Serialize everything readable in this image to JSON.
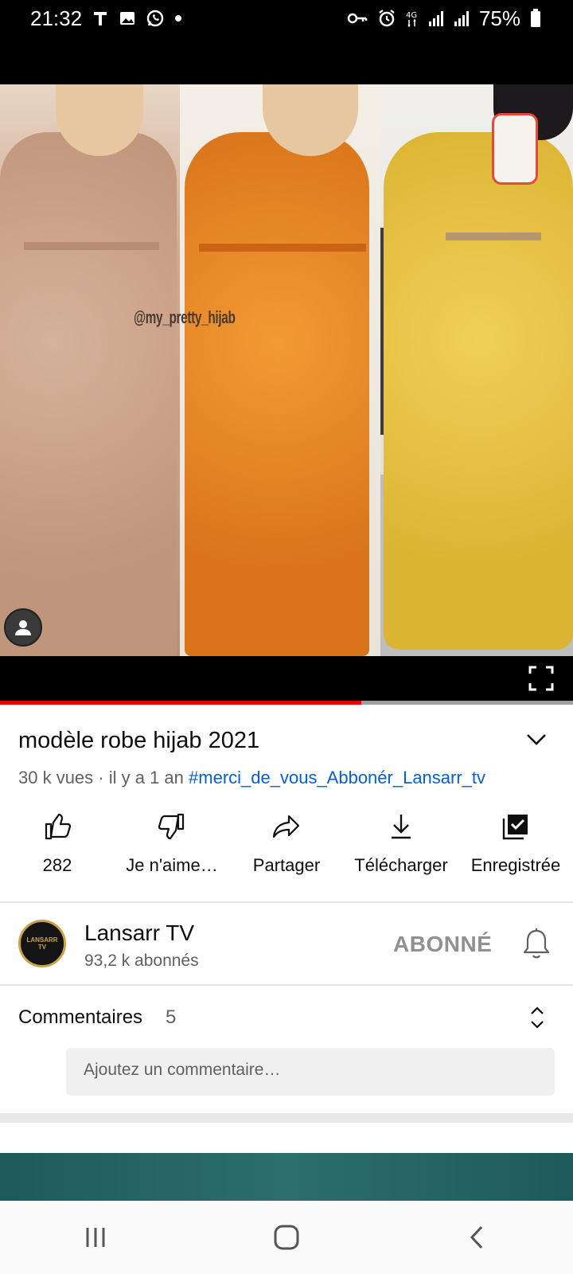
{
  "status_bar": {
    "time": "21:32",
    "battery": "75%",
    "icons": [
      "t-icon",
      "image-icon",
      "whatsapp-icon",
      "dot-icon",
      "key-icon",
      "alarm-icon",
      "4g-icon",
      "signal-icon",
      "signal-icon",
      "battery-icon"
    ]
  },
  "video": {
    "watermark": "@my_pretty_hijab",
    "progress_fraction": 0.63
  },
  "title": "modèle robe hijab 2021",
  "meta": {
    "info": "30 k vues · il y a 1 an",
    "hashtag": "#merci_de_vous_Abbonér_Lansarr_tv"
  },
  "actions": [
    {
      "label": "282",
      "icon": "thumbs-up-icon"
    },
    {
      "label": "Je n'aime…",
      "icon": "thumbs-down-icon"
    },
    {
      "label": "Partager",
      "icon": "share-icon"
    },
    {
      "label": "Télécharger",
      "icon": "download-icon"
    },
    {
      "label": "Enregistrée",
      "icon": "saved-playlist-icon"
    }
  ],
  "channel": {
    "name": "Lansarr TV",
    "subscribers": "93,2 k abonnés",
    "subscribe_label": "ABONNÉ",
    "avatar_text_top": "LANSARR",
    "avatar_text_bottom": "TV"
  },
  "comments": {
    "label": "Commentaires",
    "count": "5",
    "placeholder": "Ajoutez un commentaire…"
  },
  "colors": {
    "link": "#065fd4",
    "progress": "#e00000",
    "secondary_text": "#606060"
  }
}
